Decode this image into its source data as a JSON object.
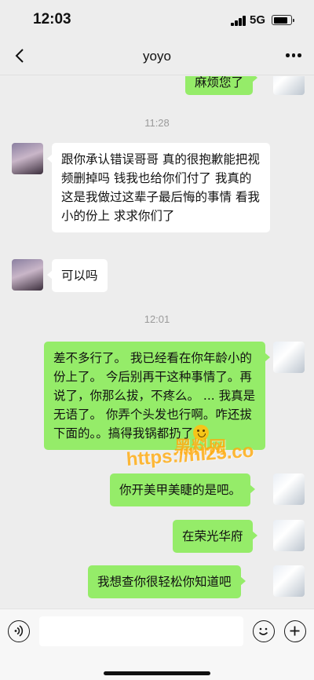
{
  "status_bar": {
    "time": "12:03",
    "network": "5G"
  },
  "header": {
    "title": "yoyo"
  },
  "timestamps": [
    "11:28",
    "12:01"
  ],
  "messages": [
    {
      "sender": "self",
      "text": "麻烦您了"
    },
    {
      "sender": "other",
      "text": "跟你承认错误哥哥 真的很抱歉能把视频删掉吗 钱我也给你们付了 我真的这是我做过这辈子最后悔的事情 看我小的份上 求求你们了"
    },
    {
      "sender": "other",
      "text": "可以吗"
    },
    {
      "sender": "self",
      "text": "差不多行了。 我已经看在你年龄小的份上了。 今后别再干这种事情了。再说了，你那么拔，不疼么。 ... 我真是无语了。 你弄个头发也行啊。咋还拔下面的。。搞得我锅都扔了",
      "emoji": "grinning-emoji"
    },
    {
      "sender": "self",
      "text": "你开美甲美睫的是吧。"
    },
    {
      "sender": "self",
      "text": "在荣光华府"
    },
    {
      "sender": "self",
      "text": "我想查你很轻松你知道吧"
    }
  ],
  "watermark": {
    "line1": "黑料网",
    "line2": "https://hl25.co"
  },
  "colors": {
    "self_bubble": "#95ec69",
    "other_bubble": "#ffffff",
    "background": "#ededed"
  }
}
